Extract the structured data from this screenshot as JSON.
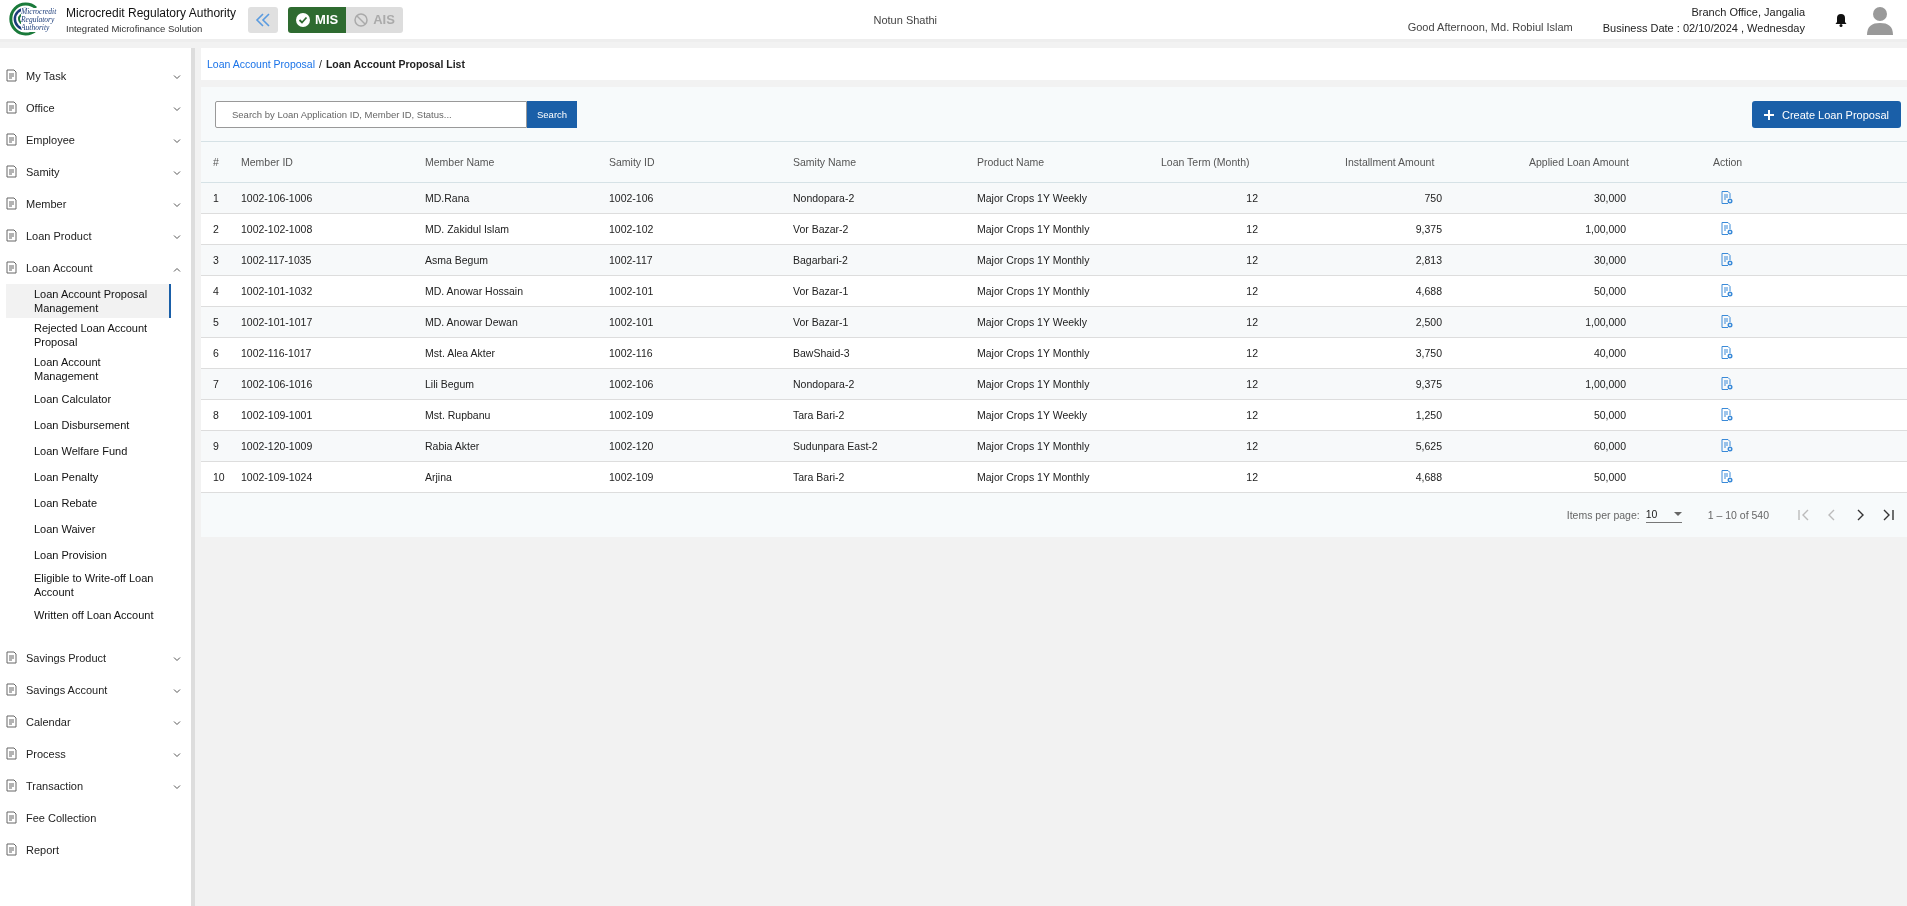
{
  "header": {
    "org_name": "Microcredit Regulatory Authority",
    "org_subtitle": "Integrated Microfinance Solution",
    "logo_text": [
      "Microcredit",
      "Regulatory",
      "Authority"
    ],
    "modules": [
      {
        "label": "MIS",
        "selected": true
      },
      {
        "label": "AIS",
        "selected": false
      }
    ],
    "app_name": "Notun Shathi",
    "greeting": "Good Afternoon, Md. Robiul Islam",
    "branch": "Branch Office, Jangalia",
    "business_date": "Business Date : 02/10/2024 , Wednesday"
  },
  "sidebar": {
    "items": [
      {
        "label": "My Task",
        "kind": "group",
        "expanded": false
      },
      {
        "label": "Office",
        "kind": "group",
        "expanded": false
      },
      {
        "label": "Employee",
        "kind": "group",
        "expanded": false
      },
      {
        "label": "Samity",
        "kind": "group",
        "expanded": false
      },
      {
        "label": "Member",
        "kind": "group",
        "expanded": false
      },
      {
        "label": "Loan Product",
        "kind": "group",
        "expanded": false
      },
      {
        "label": "Loan Account",
        "kind": "group",
        "expanded": true,
        "children": [
          {
            "label": "Loan Account Proposal Management",
            "selected": true
          },
          {
            "label": "Rejected Loan Account Proposal",
            "selected": false
          },
          {
            "label": "Loan Account Management",
            "selected": false
          },
          {
            "label": "Loan Calculator",
            "selected": false
          },
          {
            "label": "Loan Disbursement",
            "selected": false
          },
          {
            "label": "Loan Welfare Fund",
            "selected": false
          },
          {
            "label": "Loan Penalty",
            "selected": false
          },
          {
            "label": "Loan Rebate",
            "selected": false
          },
          {
            "label": "Loan Waiver",
            "selected": false
          },
          {
            "label": "Loan Provision",
            "selected": false
          },
          {
            "label": "Eligible to Write-off Loan Account",
            "selected": false
          },
          {
            "label": "Written off Loan Account",
            "selected": false
          }
        ]
      },
      {
        "label": "Savings Product",
        "kind": "group",
        "expanded": false
      },
      {
        "label": "Savings Account",
        "kind": "group",
        "expanded": false
      },
      {
        "label": "Calendar",
        "kind": "group",
        "expanded": false
      },
      {
        "label": "Process",
        "kind": "group",
        "expanded": false
      },
      {
        "label": "Transaction",
        "kind": "group",
        "expanded": false
      },
      {
        "label": "Fee Collection",
        "kind": "link"
      },
      {
        "label": "Report",
        "kind": "link"
      }
    ]
  },
  "breadcrumb_separator": "/",
  "breadcrumb": [
    {
      "label": "Loan Account Proposal",
      "kind": "link"
    },
    {
      "label": "Loan Account Proposal List",
      "kind": "current"
    }
  ],
  "search": {
    "placeholder": "Search by Loan Application ID, Member ID, Status...",
    "button": "Search"
  },
  "create_button": "Create Loan Proposal",
  "table": {
    "columns": [
      "#",
      "Member ID",
      "Member Name",
      "Samity ID",
      "Samity Name",
      "Product Name",
      "Loan Term (Month)",
      "Installment Amount",
      "Applied Loan Amount",
      "Action"
    ],
    "rows": [
      [
        "1",
        "1002-106-1006",
        "MD.Rana",
        "1002-106",
        "Nondopara-2",
        "Major Crops 1Y Weekly",
        "12",
        "750",
        "30,000"
      ],
      [
        "2",
        "1002-102-1008",
        "MD. Zakidul Islam",
        "1002-102",
        "Vor Bazar-2",
        "Major Crops 1Y Monthly",
        "12",
        "9,375",
        "1,00,000"
      ],
      [
        "3",
        "1002-117-1035",
        "Asma Begum",
        "1002-117",
        "Bagarbari-2",
        "Major Crops 1Y Monthly",
        "12",
        "2,813",
        "30,000"
      ],
      [
        "4",
        "1002-101-1032",
        "MD. Anowar Hossain",
        "1002-101",
        "Vor Bazar-1",
        "Major Crops 1Y Monthly",
        "12",
        "4,688",
        "50,000"
      ],
      [
        "5",
        "1002-101-1017",
        "MD. Anowar Dewan",
        "1002-101",
        "Vor Bazar-1",
        "Major Crops 1Y Weekly",
        "12",
        "2,500",
        "1,00,000"
      ],
      [
        "6",
        "1002-116-1017",
        "Mst. Alea Akter",
        "1002-116",
        "BawShaid-3",
        "Major Crops 1Y Monthly",
        "12",
        "3,750",
        "40,000"
      ],
      [
        "7",
        "1002-106-1016",
        "Lili Begum",
        "1002-106",
        "Nondopara-2",
        "Major Crops 1Y Monthly",
        "12",
        "9,375",
        "1,00,000"
      ],
      [
        "8",
        "1002-109-1001",
        "Mst. Rupbanu",
        "1002-109",
        "Tara Bari-2",
        "Major Crops 1Y Weekly",
        "12",
        "1,250",
        "50,000"
      ],
      [
        "9",
        "1002-120-1009",
        "Rabia Akter",
        "1002-120",
        "Sudunpara East-2",
        "Major Crops 1Y Monthly",
        "12",
        "5,625",
        "60,000"
      ],
      [
        "10",
        "1002-109-1024",
        "Arjina",
        "1002-109",
        "Tara Bari-2",
        "Major Crops 1Y Monthly",
        "12",
        "4,688",
        "50,000"
      ]
    ]
  },
  "pagination": {
    "items_per_page_label": "Items per page:",
    "items_per_page": "10",
    "range": "1 – 10 of 540",
    "buttons": [
      {
        "kind": "first",
        "disabled": true
      },
      {
        "kind": "prev",
        "disabled": true
      },
      {
        "kind": "next",
        "disabled": false
      },
      {
        "kind": "last",
        "disabled": false
      }
    ]
  }
}
